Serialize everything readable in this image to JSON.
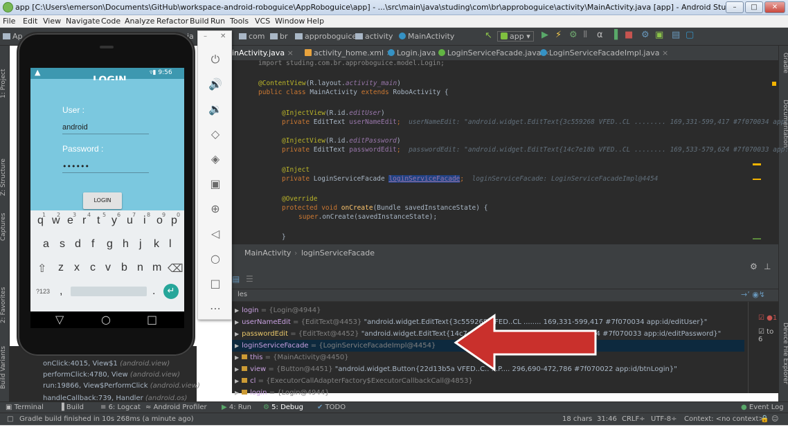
{
  "window": {
    "title": "app [C:\\Users\\emerson\\Documents\\GitHub\\workspace-android-roboguice\\AppRoboguice\\app] - ...\\src\\main\\java\\studing\\com\\br\\approboguice\\activity\\MainActivity.java [app] - Android Studio"
  },
  "menu": [
    "File",
    "Edit",
    "View",
    "Navigate",
    "Code",
    "Analyze",
    "Refactor",
    "Build",
    "Run",
    "Tools",
    "VCS",
    "Window",
    "Help"
  ],
  "toolbar": {
    "crumbs": [
      "com",
      "br",
      "approboguice",
      "activity",
      "MainActivity"
    ],
    "run_config": "app",
    "left_label": "Ap",
    "partial_a": "ia"
  },
  "left_tabs": [
    "1: Project",
    "Z: Structure",
    "Captures",
    "2: Favorites",
    "Build Variants"
  ],
  "right_tabs": [
    "Gradle",
    "Documentation",
    "Device File Explorer"
  ],
  "editor_tabs": [
    {
      "label": "inActivity.java",
      "active": true
    },
    {
      "label": "activity_home.xml"
    },
    {
      "label": "Login.java"
    },
    {
      "label": "LoginServiceFacade.java"
    },
    {
      "label": "LoginServiceFacadeImpl.java"
    }
  ],
  "code": {
    "l0": "import studing.com.br.approboguice.model.Login;",
    "l1_ann": "@ContentView",
    "l1_rest": "(R.layout.",
    "l1_fld": "activity_main",
    "l1_end": ")",
    "l2_a": "public class ",
    "l2_b": "MainActivity ",
    "l2_c": "extends ",
    "l2_d": "RoboActivity {",
    "l3_ann": "@InjectView",
    "l3_rest": "(R.id.",
    "l3_fld": "editUser",
    "l3_end": ")",
    "l4_kw": "private ",
    "l4_type": "EditText ",
    "l4_fld": "userNameEdit",
    "l4_semi": ";",
    "l4_inl": "userNameEdit: \"android.widget.EditText{3c559268 VFED..CL ........ 169,331-599,417 #7f070034 app:",
    "l5_ann": "@InjectView",
    "l5_rest": "(R.id.",
    "l5_fld": "editPassword",
    "l5_end": ")",
    "l6_kw": "private ",
    "l6_type": "EditText ",
    "l6_fld": "passwordEdit",
    "l6_semi": ";",
    "l6_inl": "passwordEdit: \"android.widget.EditText{14c7e18b VFED..CL ........ 169,533-579,624 #7f070033 app:",
    "l7_ann": "@Inject",
    "l8_kw": "private ",
    "l8_type": "LoginServiceFacade ",
    "l8_fld": "loginServiceFacade",
    "l8_semi": ";",
    "l8_inl": "loginServiceFacade: LoginServiceFacadeImpl@4454",
    "l9_ann": "@Override",
    "l10_kw": "protected void ",
    "l10_fn": "onCreate",
    "l10_rest": "(Bundle savedInstanceState) {",
    "l11_kw": "super",
    "l11_rest": ".onCreate(savedInstanceState);",
    "l12": "}"
  },
  "editor_breadcrumb": [
    "MainActivity",
    "loginServiceFacade"
  ],
  "debug": {
    "header": "les",
    "vars": [
      {
        "name": "login",
        "value": "= {Login@4944}"
      },
      {
        "name": "userNameEdit",
        "type": "= {EditText@4453}",
        "value": "\"android.widget.EditText{3c559268 VFED..CL ........ 169,331-599,417 #7f070034 app:id/editUser}\""
      },
      {
        "name": "passwordEdit",
        "type": "= {EditText@4452}",
        "value": "\"android.widget.EditText{14c7e18b VFED..CL ........ 169,533-579,624 #7f070033 app:id/editPassword}\""
      },
      {
        "name": "loginServiceFacade",
        "type": "= {LoginServiceFacadeImpl@4454}",
        "value": ""
      },
      {
        "name": "this",
        "type": "= {MainActivity@4450}",
        "value": ""
      },
      {
        "name": "view",
        "type": "= {Button@4451}",
        "value": "\"android.widget.Button{22d13b5a VFED..C.. ...P.... 296,690-472,786 #7f070022 app:id/btnLogin}\""
      },
      {
        "name": "cl",
        "type": "= {ExecutorCallAdapterFactory$ExecutorCallbackCall@4853}",
        "value": ""
      },
      {
        "name": "login",
        "type": "= {Login@4944}",
        "value": ""
      }
    ],
    "right_snip": [
      "1",
      "to 6"
    ]
  },
  "frames": [
    {
      "text": "onClick:4015, View$1 ",
      "pkg": "(android.view)"
    },
    {
      "text": "performClick:4780, View ",
      "pkg": "(android.view)"
    },
    {
      "text": "run:19866, View$PerformClick ",
      "pkg": "(android.view)"
    },
    {
      "text": "handleCallback:739, Handler ",
      "pkg": "(android.os)"
    }
  ],
  "toolwindows": [
    "Terminal",
    "Build",
    "6: Logcat",
    "Android Profiler",
    "4: Run",
    "5: Debug",
    "TODO",
    "Event Log"
  ],
  "status": {
    "message": "Gradle build finished in 10s 268ms (a minute ago)",
    "chars": "18 chars",
    "pos": "31:46",
    "crlf": "CRLF÷",
    "enc": "UTF-8÷",
    "context": "Context: <no context>"
  },
  "phone": {
    "title": "LOGIN",
    "time": "9:56",
    "user_label": "User :",
    "user_value": "android",
    "password_label": "Password :",
    "password_value": "••••••",
    "login_button": "LOGIN",
    "kb_row1": [
      "q",
      "w",
      "e",
      "r",
      "t",
      "y",
      "u",
      "i",
      "o",
      "p"
    ],
    "kb_row1_hints": [
      "1",
      "2",
      "3",
      "4",
      "5",
      "6",
      "7",
      "8",
      "9",
      "0"
    ],
    "kb_row2": [
      "a",
      "s",
      "d",
      "f",
      "g",
      "h",
      "j",
      "k",
      "l"
    ],
    "kb_row3": [
      "z",
      "x",
      "c",
      "v",
      "b",
      "n",
      "m"
    ],
    "kb_symbols": "?123",
    "kb_comma": ",",
    "kb_period": "."
  },
  "colors": {
    "accent_red_arrow": "#c9302c",
    "ide_bg": "#2b2b2b",
    "phone_screen": "#7bc8df"
  }
}
